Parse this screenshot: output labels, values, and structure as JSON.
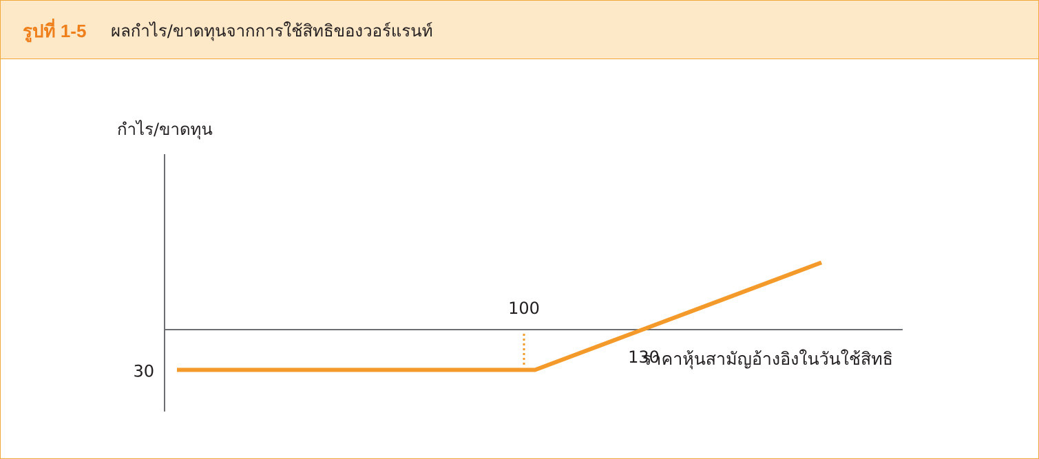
{
  "figure": {
    "number": "รูปที่ 1-5",
    "title": "ผลกำไร/ขาดทุนจากการใช้สิทธิของวอร์แรนท์"
  },
  "colors": {
    "accent": "#f39a2b",
    "header_bg": "#fde8c8",
    "border": "#f0a83c",
    "figure_number": "#ef7f1a",
    "axis": "#6d6e71"
  },
  "chart_data": {
    "type": "line",
    "title": "",
    "ylabel": "กำไร/ขาดทุน",
    "xlabel": "ราคาหุ้นสามัญอ้างอิงในวันใช้สิทธิ",
    "labels": {
      "loss": "30",
      "exercise_price": "100",
      "breakeven": "130"
    },
    "series": [
      {
        "x": [
          0,
          100,
          130,
          180
        ],
        "y": [
          -30,
          -30,
          0,
          50
        ]
      }
    ],
    "exercise_marker": {
      "x": 100,
      "style": "dotted"
    },
    "xlim": [
      0,
      230
    ],
    "ylim": [
      -55,
      75
    ],
    "grid": false
  }
}
